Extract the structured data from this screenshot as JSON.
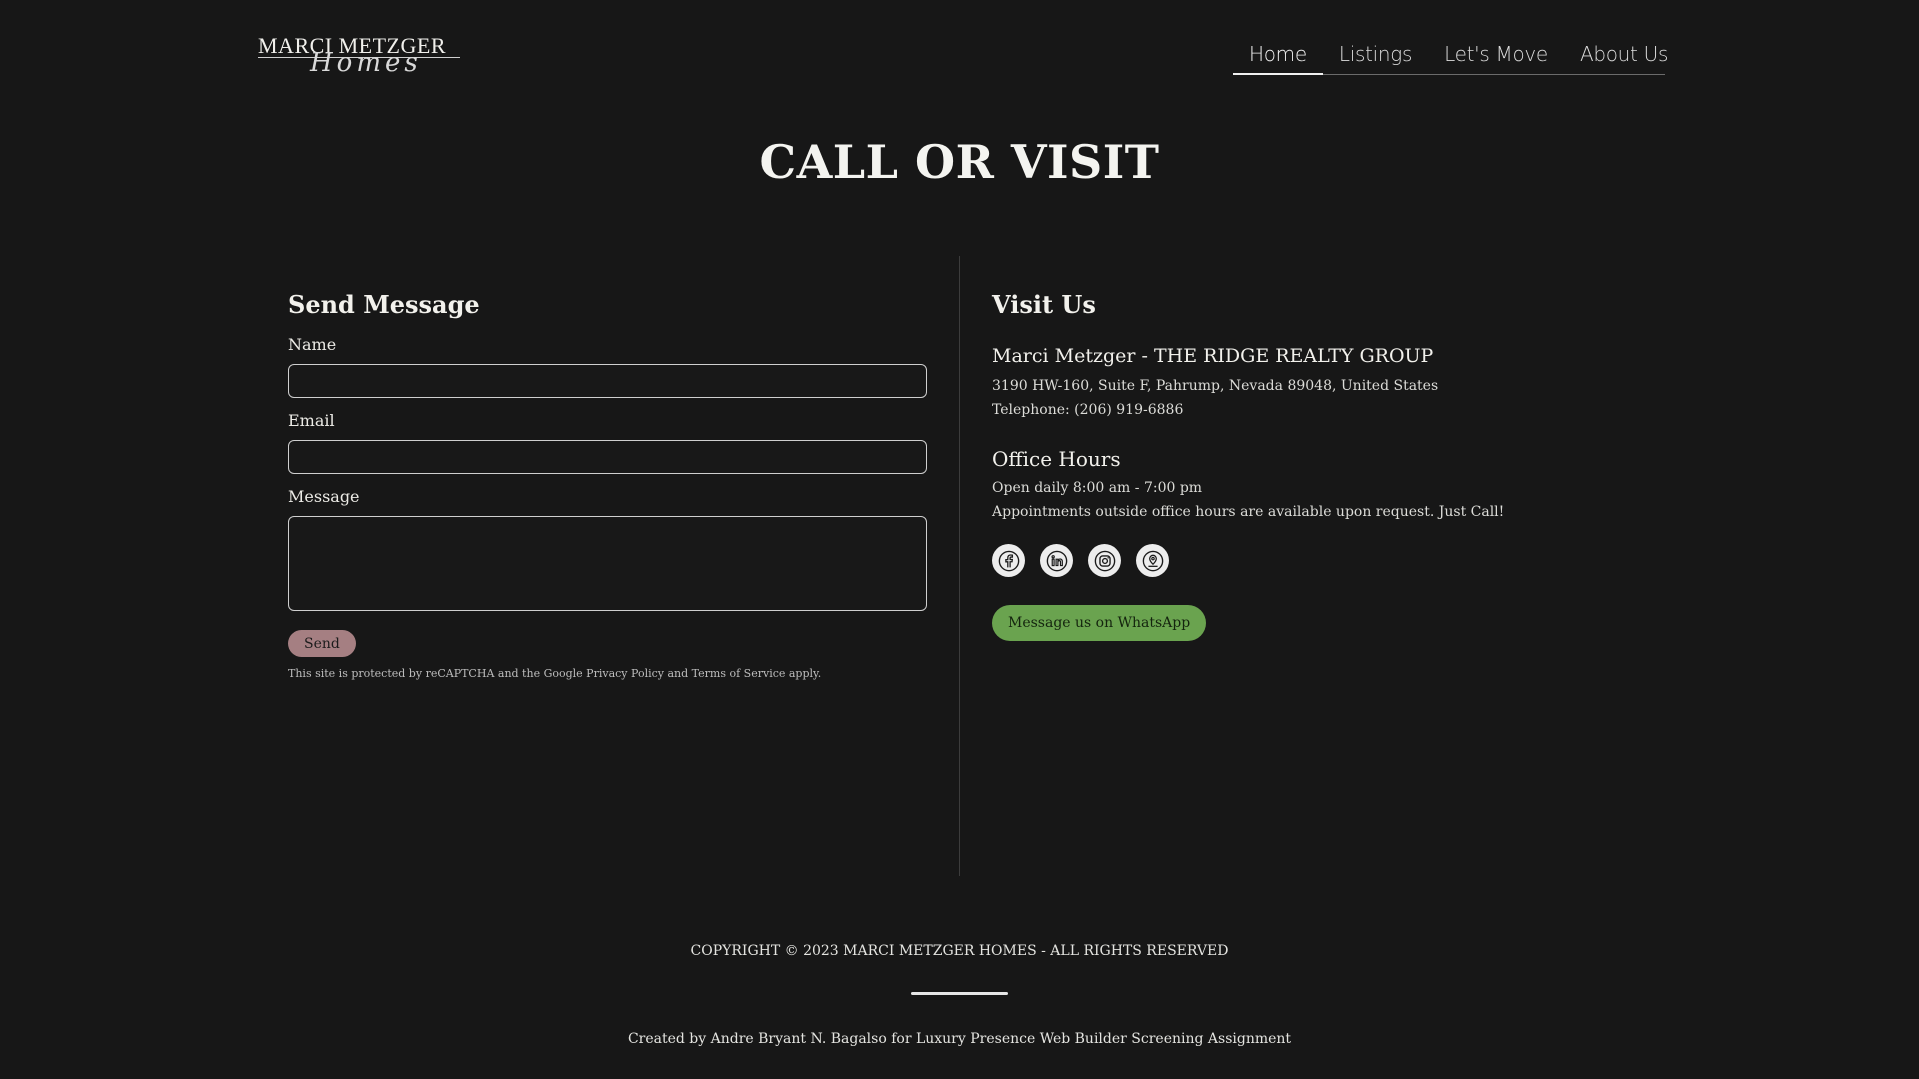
{
  "logo": {
    "name": "MARCI METZGER",
    "script": "Homes"
  },
  "nav": {
    "items": [
      "Home",
      "Listings",
      "Let's Move",
      "About Us"
    ]
  },
  "page_title": "CALL OR VISIT",
  "send_message": {
    "heading": "Send Message",
    "name_label": "Name",
    "name_value": "",
    "email_label": "Email",
    "email_value": "",
    "message_label": "Message",
    "message_value": "",
    "send_label": "Send",
    "recaptcha_text": "This site is protected by reCAPTCHA and the Google Privacy Policy and Terms of Service apply."
  },
  "visit_us": {
    "heading": "Visit Us",
    "company": "Marci Metzger - THE RIDGE REALTY GROUP",
    "address": "3190 HW-160, Suite F, Pahrump, Nevada 89048, United States",
    "telephone": "Telephone: (206) 919-6886",
    "hours_heading": "Office Hours",
    "hours": "Open daily 8:00 am - 7:00 pm",
    "appointments": "Appointments outside office hours are available upon request. Just Call!",
    "socials": [
      "facebook-icon",
      "linkedin-icon",
      "instagram-icon",
      "map-pin-icon"
    ],
    "whatsapp_label": "Message us on WhatsApp"
  },
  "footer": {
    "copyright": "COPYRIGHT © 2023 MARCI METZGER HOMES - ALL RIGHTS RESERVED",
    "credit": "Created by Andre Bryant N. Bagalso for Luxury Presence Web Builder Screening Assignment"
  },
  "colors": {
    "background": "#171717",
    "send_button": "#a57f82",
    "whatsapp_button": "#6aa34f"
  }
}
